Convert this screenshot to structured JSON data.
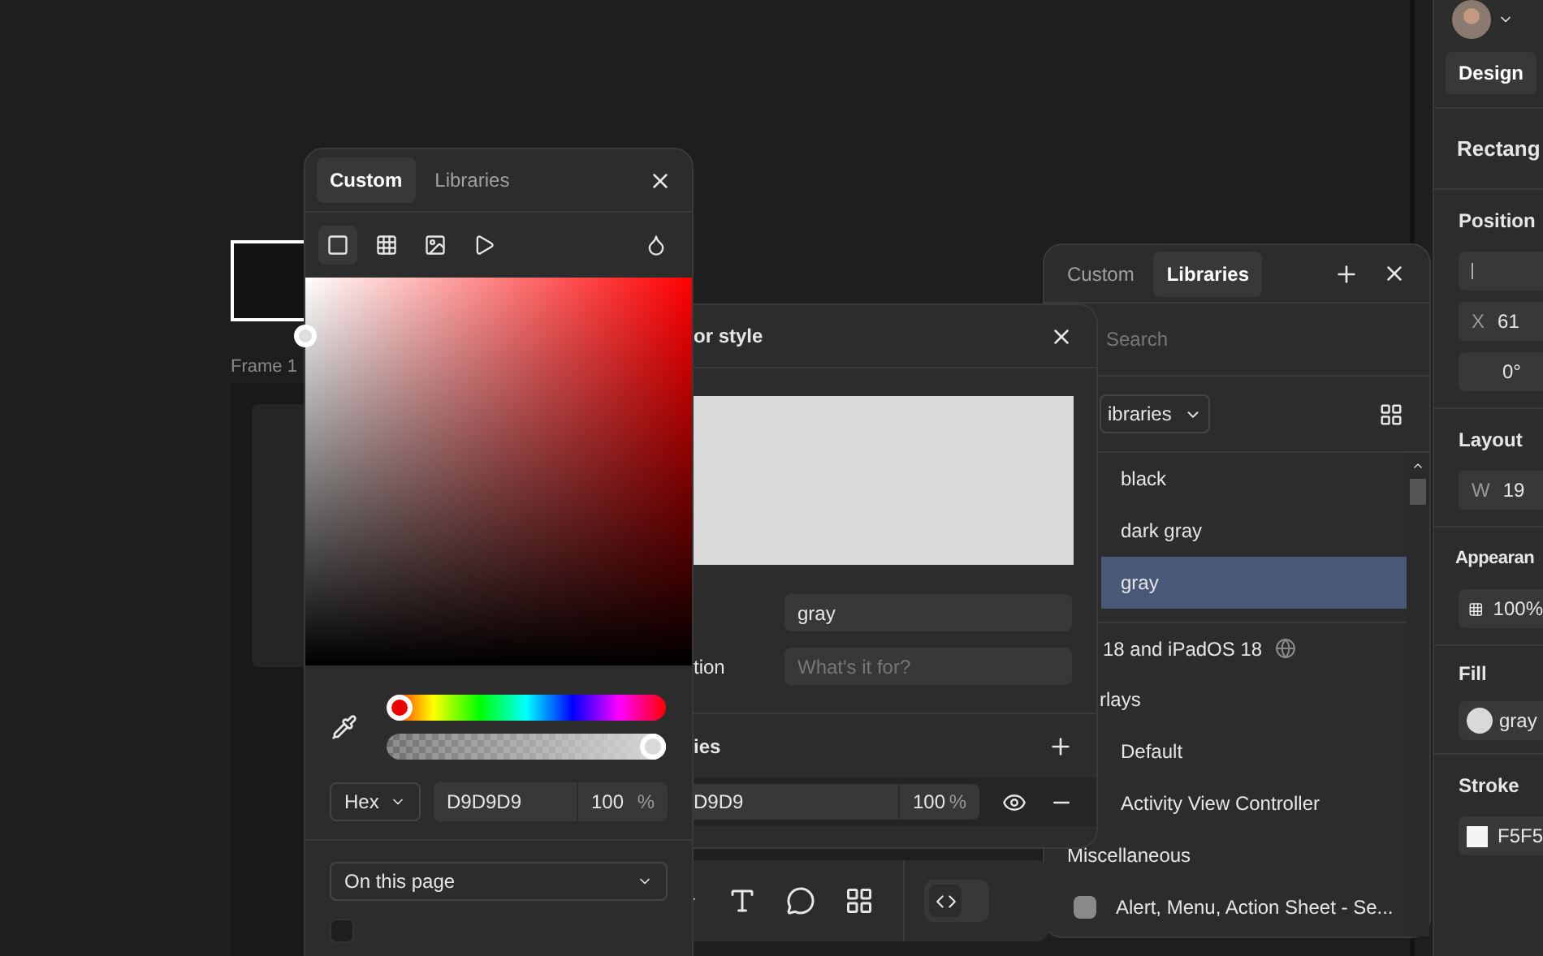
{
  "canvas": {
    "frame_label": "Frame 1"
  },
  "color_picker": {
    "tabs": [
      {
        "label": "Custom",
        "selected": true
      },
      {
        "label": "Libraries",
        "selected": false
      }
    ],
    "fill_types": [
      {
        "kind": "solid",
        "selected": true
      },
      {
        "kind": "gradient",
        "selected": false
      },
      {
        "kind": "image",
        "selected": false
      },
      {
        "kind": "video",
        "selected": false
      }
    ],
    "hue": {
      "level": 0
    },
    "alpha": {
      "level": 1
    },
    "format": "Hex",
    "hex": "D9D9D9",
    "opacity": "100",
    "percent": "%",
    "scope": "On this page"
  },
  "toolbar": {
    "dev_mode": {
      "on": false
    }
  },
  "style_panel": {
    "title": "or style",
    "name_value": "gray",
    "description_label": "tion",
    "description_placeholder": "What's it for?",
    "properties_label": "ies",
    "hex": "D9D9",
    "opacity": "100",
    "percent": "%"
  },
  "libraries_panel": {
    "tabs": [
      {
        "label": "Custom",
        "selected": false
      },
      {
        "label": "Libraries",
        "selected": true
      }
    ],
    "search_placeholder": "Search",
    "filter": "ibraries",
    "styles": [
      {
        "label": "black",
        "selected": false
      },
      {
        "label": "dark gray",
        "selected": false
      },
      {
        "label": "gray",
        "selected": true
      }
    ],
    "library_title": "18 and iPadOS 18",
    "group": "rlays",
    "items": [
      {
        "label": "Default"
      },
      {
        "label": "Activity View Controller"
      }
    ],
    "group2": "Miscellaneous",
    "item2": "Alert, Menu, Action Sheet - Se..."
  },
  "inspector": {
    "tabs": [
      {
        "label": "Design",
        "selected": true
      }
    ],
    "title": "Rectang",
    "position_label": "Position",
    "x_label": "X",
    "x_value": "61",
    "rotation": "0°",
    "layout_label": "Layout",
    "w_label": "W",
    "w_value": "19",
    "appearance_label": "Appearan",
    "opacity": "100%",
    "fill_label": "Fill",
    "fill_name": "gray",
    "stroke_label": "Stroke",
    "stroke_value": "F5F5"
  }
}
